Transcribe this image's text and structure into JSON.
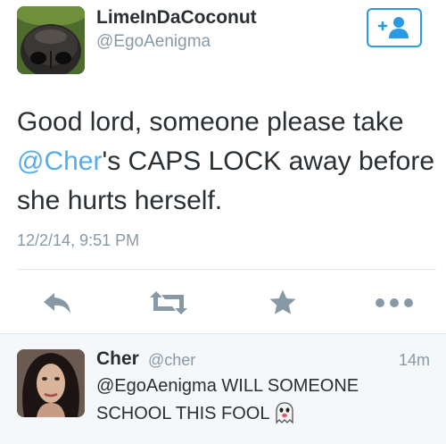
{
  "tweet": {
    "author_name": "LimeInDaCoconut",
    "author_handle": "@EgoAenigma",
    "text_before": "Good lord, someone please take ",
    "mention": "@Cher",
    "text_after": "'s CAPS LOCK away before she hurts herself.",
    "timestamp": "12/2/14, 9:51 PM"
  },
  "actions": {
    "reply_icon": "reply-icon",
    "retweet_icon": "retweet-icon",
    "favorite_icon": "star-icon",
    "more_icon": "more-dots-icon"
  },
  "follow_button": {
    "icon": "follow-user-plus-icon"
  },
  "reply": {
    "author_name": "Cher",
    "author_handle": "@cher",
    "time": "14m",
    "text": "@EgoAenigma WILL SOMEONE SCHOOL THIS FOOL",
    "emoji": "ghost-emoji"
  },
  "colors": {
    "link": "#55acee",
    "follow_border": "#2a9ae3",
    "icon_gray": "#8899a6",
    "text": "#292f33",
    "muted": "#8899a6",
    "reply_bg": "#f5f8fa"
  }
}
